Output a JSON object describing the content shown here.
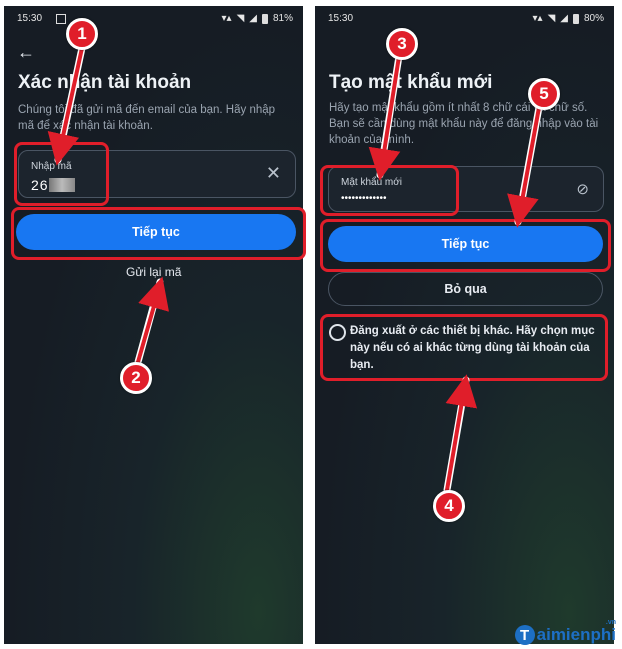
{
  "left": {
    "status": {
      "time": "15:30",
      "battery": "81%"
    },
    "title": "Xác nhận tài khoản",
    "description": "Chúng tôi đã gửi mã đến email của bạn. Hãy nhập mã để xác nhận tài khoản.",
    "code_field": {
      "label": "Nhập mã",
      "value": "26"
    },
    "continue_label": "Tiếp tục",
    "resend_label": "Gửi lại mã"
  },
  "right": {
    "status": {
      "time": "15:30",
      "battery": "80%"
    },
    "title": "Tạo mật khẩu mới",
    "description": "Hãy tạo mật khẩu gồm ít nhất 8 chữ cái và chữ số. Bạn sẽ cần dùng mật khẩu này để đăng nhập vào tài khoản của mình.",
    "password_field": {
      "label": "Mật khẩu mới",
      "value": "•••••••••••••"
    },
    "continue_label": "Tiếp tục",
    "skip_label": "Bỏ qua",
    "logout_option": "Đăng xuất ở các thiết bị khác. Hãy chọn mục này nếu có ai khác từng dùng tài khoản của bạn."
  },
  "steps": [
    "1",
    "2",
    "3",
    "4",
    "5"
  ],
  "watermark": {
    "brand": "aimienphi",
    "initial": "T",
    "suffix": ".vn"
  },
  "colors": {
    "accent": "#1877f2",
    "highlight": "#e01e2a",
    "background": "#161c24"
  }
}
